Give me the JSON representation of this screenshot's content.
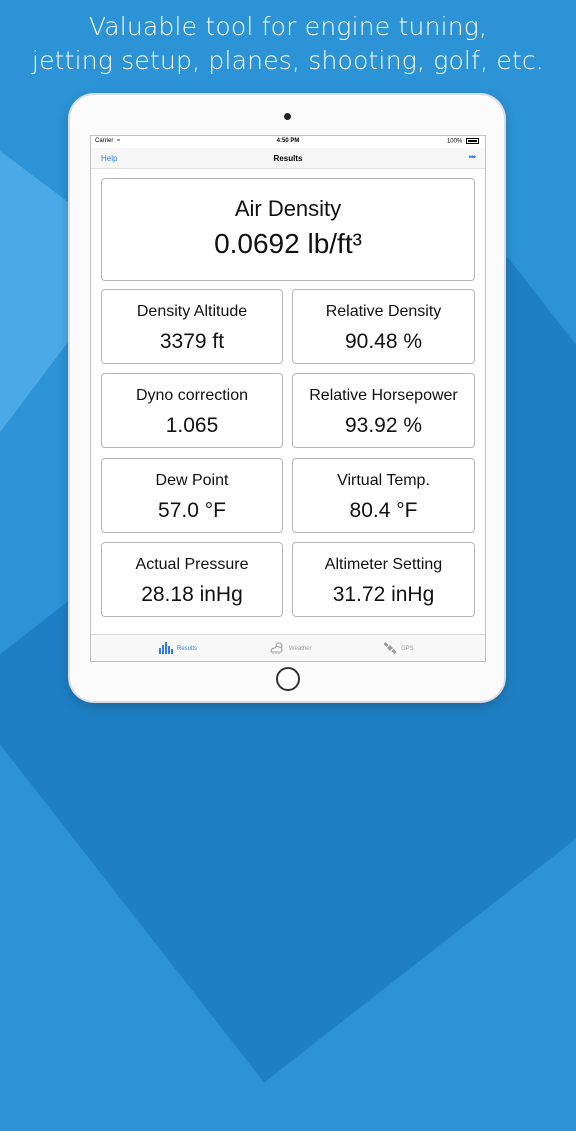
{
  "headline": {
    "line1": "Valuable tool for engine tuning,",
    "line2": "jetting setup, planes, shooting, golf, etc."
  },
  "status_bar": {
    "carrier": "Carrier",
    "time": "4:50 PM",
    "battery": "100%"
  },
  "nav": {
    "help_label": "Help",
    "title": "Results",
    "more_icon": "ellipsis-icon"
  },
  "main_card": {
    "label": "Air Density",
    "value": "0.0692 lb/ft³"
  },
  "cards": [
    {
      "label": "Density Altitude",
      "value": "3379 ft"
    },
    {
      "label": "Relative Density",
      "value": "90.48 %"
    },
    {
      "label": "Dyno correction",
      "value": "1.065"
    },
    {
      "label": "Relative Horsepower",
      "value": "93.92 %"
    },
    {
      "label": "Dew Point",
      "value": "57.0 °F"
    },
    {
      "label": "Virtual Temp.",
      "value": "80.4 °F"
    },
    {
      "label": "Actual Pressure",
      "value": "28.18 inHg"
    },
    {
      "label": "Altimeter Setting",
      "value": "31.72 inHg"
    }
  ],
  "tabs": [
    {
      "label": "Results",
      "icon": "bar-chart-icon",
      "active": true
    },
    {
      "label": "Weather",
      "icon": "weather-icon",
      "active": false
    },
    {
      "label": "GPS",
      "icon": "satellite-icon",
      "active": false
    }
  ],
  "colors": {
    "background": "#2b93d6",
    "accent": "#2f7ee8"
  }
}
